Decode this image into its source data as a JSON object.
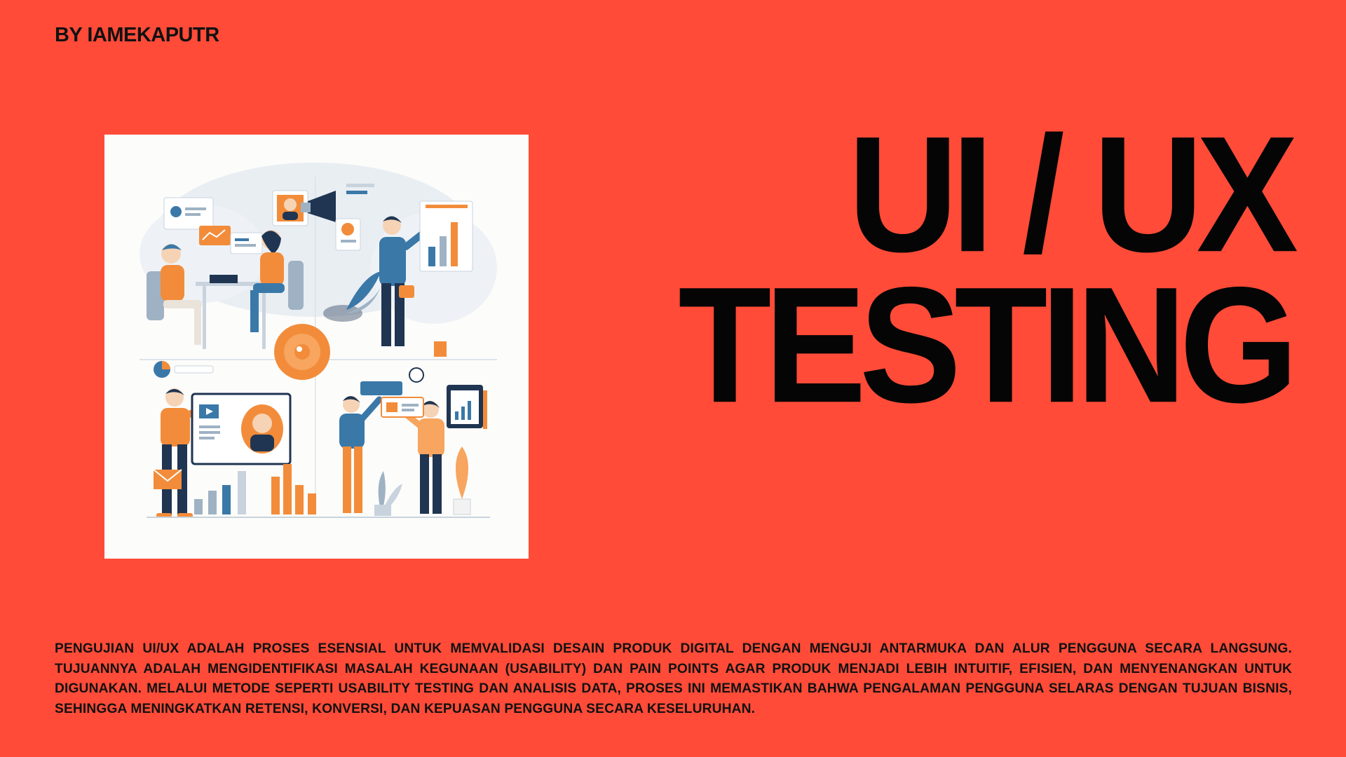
{
  "byline": "BY IAMEKAPUTR",
  "title": {
    "line1": "UI / UX",
    "line2": "TESTING"
  },
  "illustration": {
    "icon": "ui-ux-team-illustration"
  },
  "description": "PENGUJIAN UI/UX ADALAH PROSES ESENSIAL UNTUK MEMVALIDASI DESAIN PRODUK DIGITAL DENGAN MENGUJI ANTARMUKA DAN ALUR PENGGUNA SECARA LANGSUNG. TUJUANNYA ADALAH MENGIDENTIFIKASI MASALAH KEGUNAAN (USABILITY) DAN PAIN POINTS AGAR PRODUK MENJADI LEBIH INTUITIF, EFISIEN, DAN MENYENANGKAN UNTUK DIGUNAKAN. MELALUI METODE SEPERTI USABILITY TESTING DAN ANALISIS DATA, PROSES INI MEMASTIKAN BAHWA PENGALAMAN PENGGUNA SELARAS DENGAN TUJUAN BISNIS, SEHINGGA MENINGKATKAN RETENSI, KONVERSI, DAN KEPUASAN PENGGUNA SECARA KESELURUHAN.",
  "colors": {
    "background": "#ff4b38",
    "text": "#0b0b0b",
    "card": "#fcfcfa",
    "accent_orange": "#f28c3a",
    "accent_navy": "#1f3552",
    "accent_blue": "#3a78a8"
  }
}
